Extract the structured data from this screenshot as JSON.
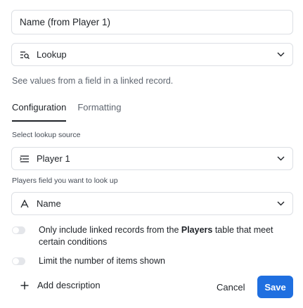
{
  "field_name": {
    "value": "Name (from Player 1)"
  },
  "field_type": {
    "label": "Lookup",
    "icon": "lookup-icon",
    "description": "See values from a field in a linked record."
  },
  "tabs": [
    {
      "label": "Configuration",
      "active": true
    },
    {
      "label": "Formatting",
      "active": false
    }
  ],
  "lookup_source": {
    "label": "Select lookup source",
    "value": "Player 1",
    "icon": "linked-record-icon"
  },
  "lookup_field": {
    "label": "Players field you want to look up",
    "value": "Name",
    "icon": "text-field-icon"
  },
  "options": {
    "conditions": {
      "text_before": "Only include linked records from the ",
      "table": "Players",
      "text_after": " table that meet certain conditions",
      "enabled": false
    },
    "limit": {
      "text": "Limit the number of items shown",
      "enabled": false
    }
  },
  "footer": {
    "add_description": "Add description",
    "cancel": "Cancel",
    "save": "Save"
  },
  "colors": {
    "accent": "#1f6fe0",
    "toggle_off": "#e4e6ea",
    "muted_text": "#5f6670"
  }
}
